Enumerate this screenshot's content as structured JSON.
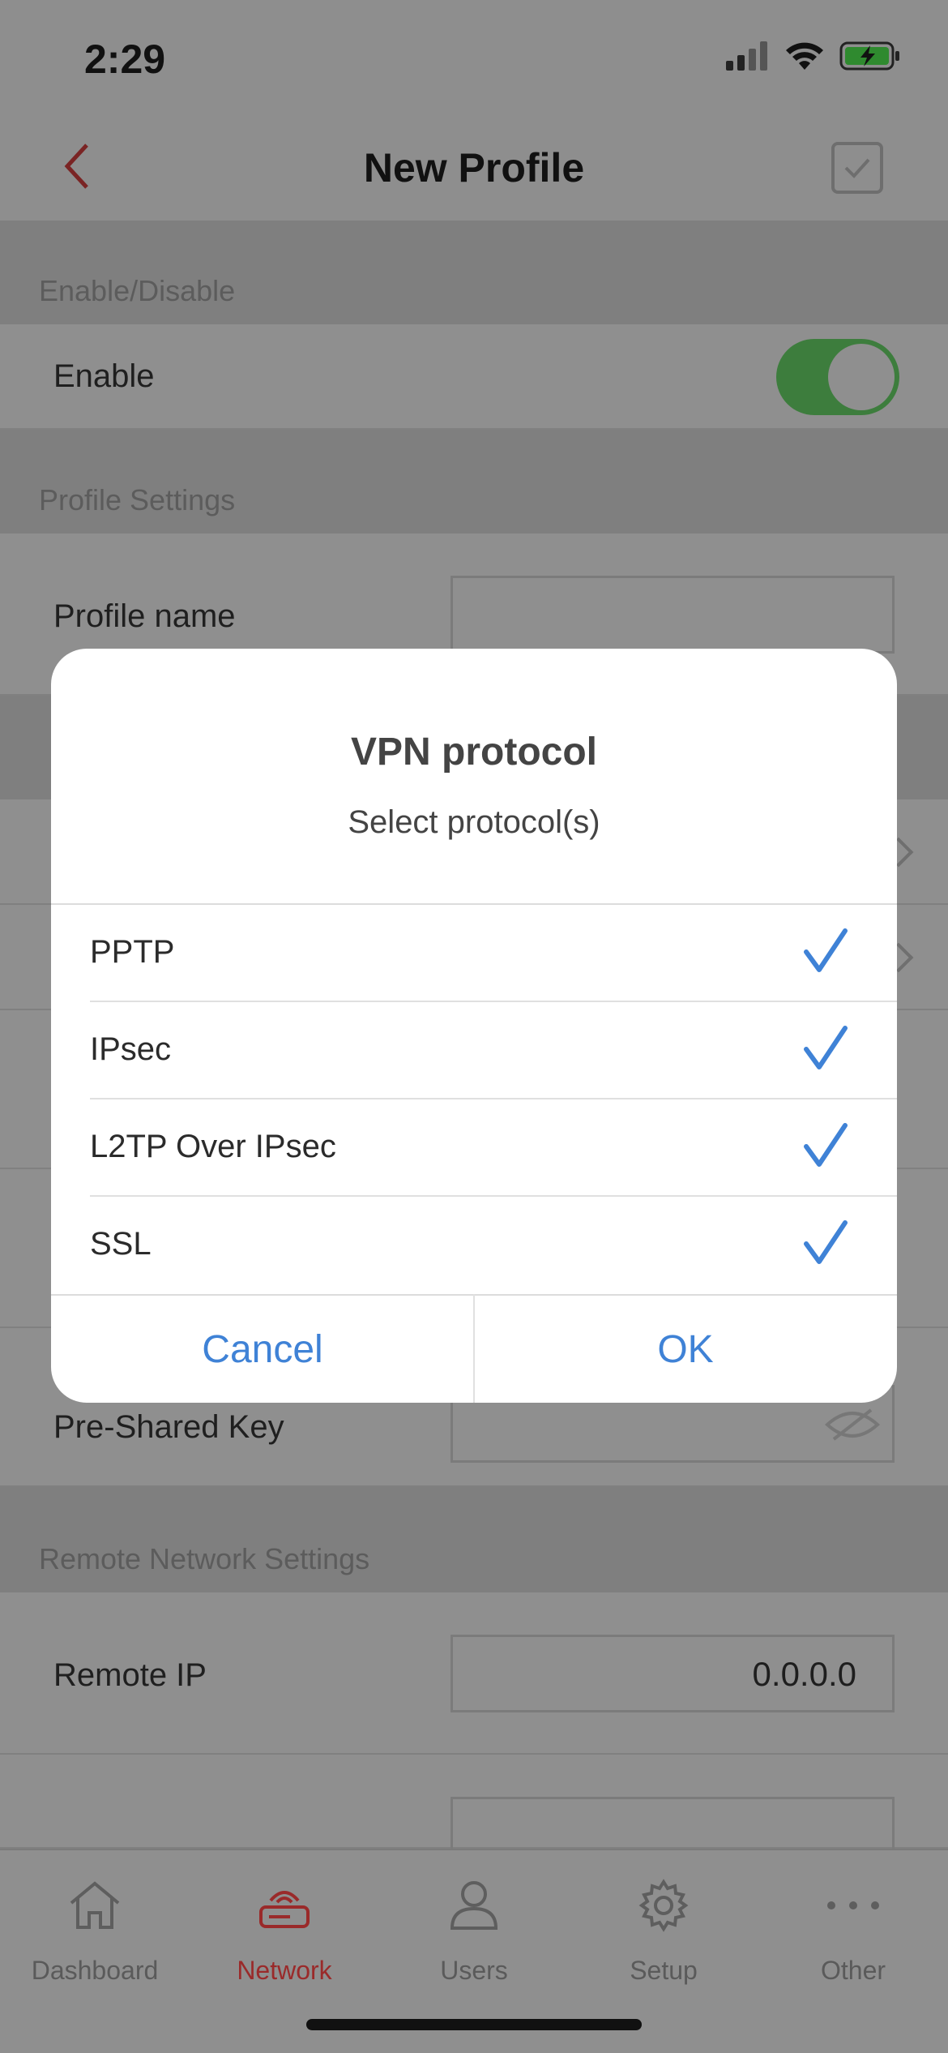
{
  "status": {
    "time": "2:29"
  },
  "nav": {
    "title": "New Profile"
  },
  "sections": {
    "enable_disable": "Enable/Disable",
    "profile_settings": "Profile Settings",
    "remote_network": "Remote Network Settings"
  },
  "rows": {
    "enable_label": "Enable",
    "profile_name_label": "Profile name",
    "profile_name_value": "",
    "psk_label": "Pre-Shared Key",
    "remote_ip_label": "Remote IP",
    "remote_ip_value": "0.0.0.0"
  },
  "dialog": {
    "title": "VPN protocol",
    "subtitle": "Select protocol(s)",
    "options": [
      {
        "label": "PPTP",
        "checked": true
      },
      {
        "label": "IPsec",
        "checked": true
      },
      {
        "label": "L2TP Over IPsec",
        "checked": true
      },
      {
        "label": "SSL",
        "checked": true
      }
    ],
    "cancel_label": "Cancel",
    "ok_label": "OK"
  },
  "tabs": [
    {
      "label": "Dashboard",
      "icon": "home-icon",
      "active": false
    },
    {
      "label": "Network",
      "icon": "router-icon",
      "active": true
    },
    {
      "label": "Users",
      "icon": "user-icon",
      "active": false
    },
    {
      "label": "Setup",
      "icon": "gear-icon",
      "active": false
    },
    {
      "label": "Other",
      "icon": "more-icon",
      "active": false
    }
  ],
  "colors": {
    "accent": "#3f82d6",
    "active_tab": "#9a2a2a",
    "toggle_on": "#3d7d3d"
  }
}
